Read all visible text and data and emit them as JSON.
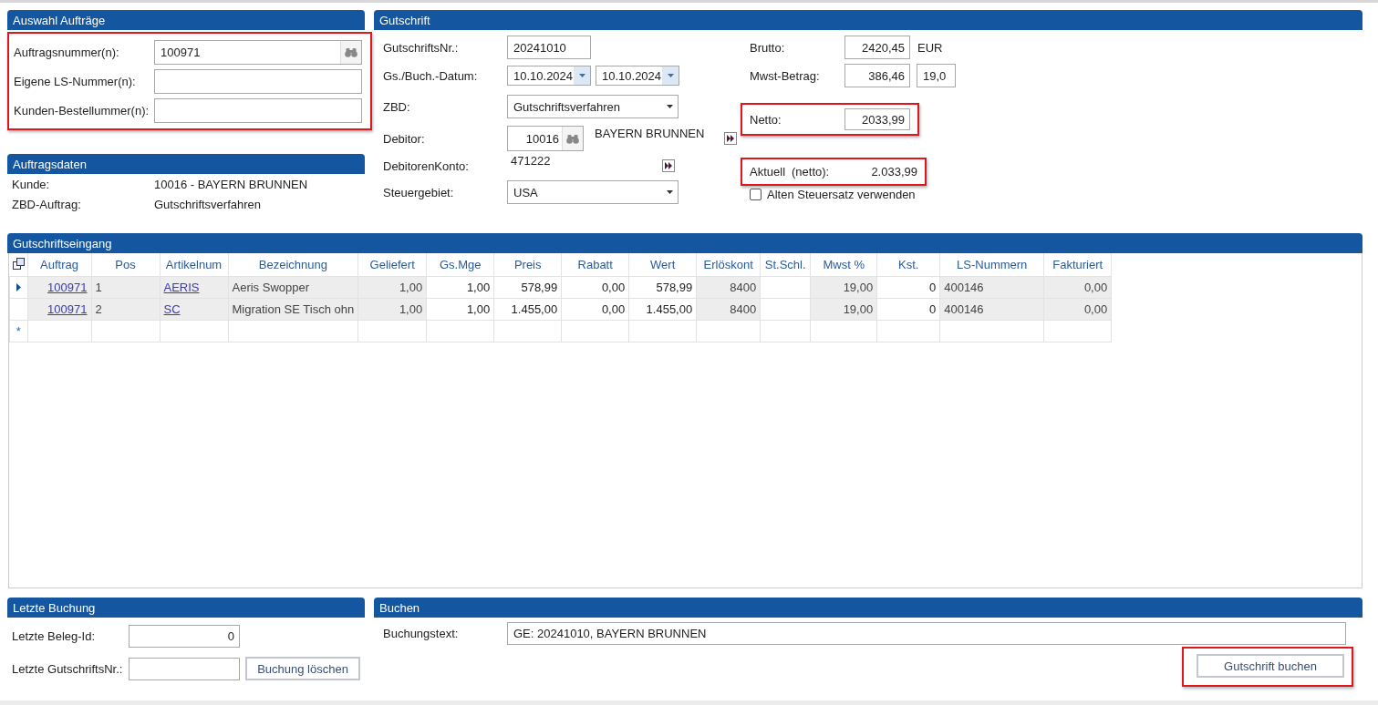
{
  "auswahl": {
    "title": "Auswahl Aufträge",
    "highlighted": true,
    "fields": [
      {
        "label": "Auftragsnummer(n):",
        "value": "100971",
        "lookup": true
      },
      {
        "label": "Eigene LS-Nummer(n):",
        "lookup": false
      },
      {
        "label": "Kunden-Bestellummer(n):",
        "lookup": false
      }
    ]
  },
  "auftragsdaten": {
    "title": "Auftragsdaten",
    "rows": [
      {
        "label": "Kunde:",
        "value": "10016 - BAYERN BRUNNEN"
      },
      {
        "label": "ZBD-Auftrag:",
        "value": "Gutschriftsverfahren"
      }
    ]
  },
  "gutschrift": {
    "title": "Gutschrift",
    "nr": {
      "label": "GutschriftsNr.:",
      "value": "20241010"
    },
    "datum": {
      "label": "Gs./Buch.-Datum:",
      "values": [
        "10.10.2024",
        "10.10.2024"
      ]
    },
    "zbd": {
      "label": "ZBD:",
      "value": "Gutschriftsverfahren"
    },
    "debitor": {
      "label": "Debitor:",
      "value": "10016",
      "name": "BAYERN BRUNNEN"
    },
    "konto": {
      "label": "DebitorenKonto:",
      "value": "471222"
    },
    "steuergebiet": {
      "label": "Steuergebiet:",
      "value": "USA"
    },
    "brutto": {
      "label": "Brutto:",
      "value": "2420,45",
      "currency": "EUR"
    },
    "mwst": {
      "label": "Mwst-Betrag:",
      "value": "386,46",
      "rate": "19,0"
    },
    "netto": {
      "label": "Netto:",
      "value": "2033,99",
      "highlighted": true
    },
    "aktuell": {
      "label": "Aktuell",
      "sublabel": "(netto):",
      "value": "2.033,99",
      "highlighted": true
    },
    "alt_steuersatz": {
      "label": "Alten Steuersatz verwenden",
      "checked": false
    }
  },
  "eingang": {
    "title": "Gutschriftseingang",
    "new_row_marker": "*",
    "columns": [
      {
        "label": "Auftrag",
        "kind": "link-number",
        "readonly": true
      },
      {
        "label": "Pos",
        "kind": "text",
        "readonly": true
      },
      {
        "label": "Artikelnum",
        "kind": "link",
        "readonly": true
      },
      {
        "label": "Bezeichnung",
        "kind": "text",
        "readonly": true
      },
      {
        "label": "Geliefert",
        "kind": "number",
        "readonly": true
      },
      {
        "label": "Gs.Mge",
        "kind": "number",
        "readonly": false
      },
      {
        "label": "Preis",
        "kind": "number",
        "readonly": false
      },
      {
        "label": "Rabatt",
        "kind": "number",
        "readonly": false
      },
      {
        "label": "Wert",
        "kind": "number",
        "readonly": false
      },
      {
        "label": "Erlöskont",
        "kind": "number",
        "readonly": true
      },
      {
        "label": "St.Schl.",
        "kind": "text",
        "readonly": false
      },
      {
        "label": "Mwst %",
        "kind": "number",
        "readonly": true
      },
      {
        "label": "Kst.",
        "kind": "number",
        "readonly": false
      },
      {
        "label": "LS-Nummern",
        "kind": "text",
        "readonly": true
      },
      {
        "label": "Fakturiert",
        "kind": "number",
        "readonly": true
      }
    ],
    "rows": [
      {
        "selected": true,
        "cells": [
          "100971",
          "1",
          "AERIS",
          "Aeris Swopper",
          "1,00",
          "1,00",
          "578,99",
          "0,00",
          "578,99",
          "8400",
          "",
          "19,00",
          "0",
          "400146",
          "0,00"
        ]
      },
      {
        "selected": false,
        "cells": [
          "100971",
          "2",
          "SC",
          "Migration SE Tisch ohn",
          "1,00",
          "1,00",
          "1.455,00",
          "0,00",
          "1.455,00",
          "8400",
          "",
          "19,00",
          "0",
          "400146",
          "0,00"
        ]
      }
    ]
  },
  "letzte": {
    "title": "Letzte Buchung",
    "fields": [
      {
        "label": "Letzte Beleg-Id:",
        "value": "0"
      },
      {
        "label": "Letzte GutschriftsNr.:"
      }
    ],
    "button": "Buchung löschen"
  },
  "buchen": {
    "title": "Buchen",
    "label": "Buchungstext:",
    "value": "GE: 20241010, BAYERN BRUNNEN",
    "button": {
      "label": "Gutschrift buchen",
      "highlighted": true
    }
  }
}
